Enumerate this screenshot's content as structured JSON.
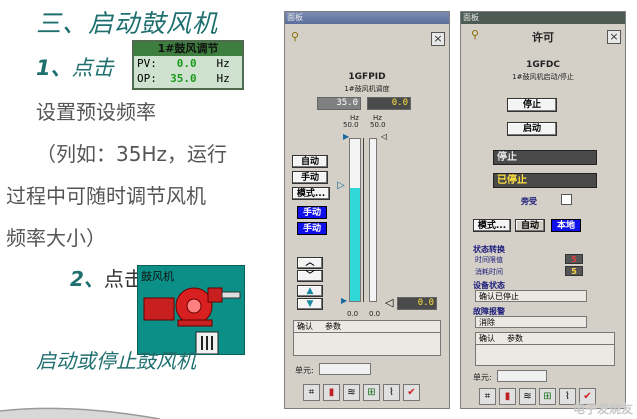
{
  "slide": {
    "title": "三、启动鼓风机",
    "step1_num": "1、",
    "step1_text": "点击",
    "line_set": "设置预设频率",
    "line_example": "（列如：35Hz，运行",
    "line_process": "过程中可随时调节风机",
    "line_size": "频率大小）",
    "step2_num": "2、",
    "step2_text": "点击",
    "action": "启动或停止鼓风机"
  },
  "pv_widget": {
    "header": "1#鼓风调节",
    "pv_label": "PV:",
    "pv_value": "0.0",
    "pv_unit": "Hz",
    "op_label": "OP:",
    "op_value": "35.0",
    "op_unit": "Hz"
  },
  "fan_widget": {
    "label": "鼓风机"
  },
  "panel1": {
    "title": "面板",
    "tag": "1GFPID",
    "desc": "1#鼓风机调度",
    "sp_value": "35.0",
    "pv_value": "0.0",
    "unit_left": "Hz",
    "unit_right": "Hz",
    "max_left": "50.0",
    "max_right": "50.0",
    "min_left": "0.0",
    "min_right": "0.0",
    "out_value": "0.0",
    "btn_auto": "自动",
    "btn_manual": "手动",
    "btn_mode": "模式...",
    "mode_blue1": "手动",
    "mode_blue2": "手动",
    "alarm_col1": "确认",
    "alarm_col2": "参数",
    "unit_label": "单元:",
    "slider_fill_fraction": 0.7
  },
  "panel2": {
    "title": "面板",
    "state_title": "许可",
    "tag": "1GFDC",
    "desc": "1#鼓风机启动/停止",
    "btn_stop": "停止",
    "btn_start": "启动",
    "status1": "停止",
    "status2": "已停止",
    "bypass_label": "旁受",
    "btn_mode": "模式...",
    "mode_auto": "自动",
    "mode_local": "本地",
    "section_transition": "状态转换",
    "time_limit_label": "时间限值",
    "time_limit_value": "5",
    "elapsed_label": "消耗时间",
    "elapsed_value": "5",
    "section_device": "设备状态",
    "device_state": "确认已停止",
    "section_fault": "故障报警",
    "fault_state": "消除",
    "alarm_col1": "确认",
    "alarm_col2": "参数",
    "unit_label": "单元:"
  },
  "watermark": "电子发烧友",
  "colors": {
    "accent": "#1f6f6f",
    "cyan_fill": "#30d8d8",
    "mode_blue": "#1010e8",
    "status_bar": "#4a4a4a",
    "status_text_yellow": "#ffe040"
  }
}
